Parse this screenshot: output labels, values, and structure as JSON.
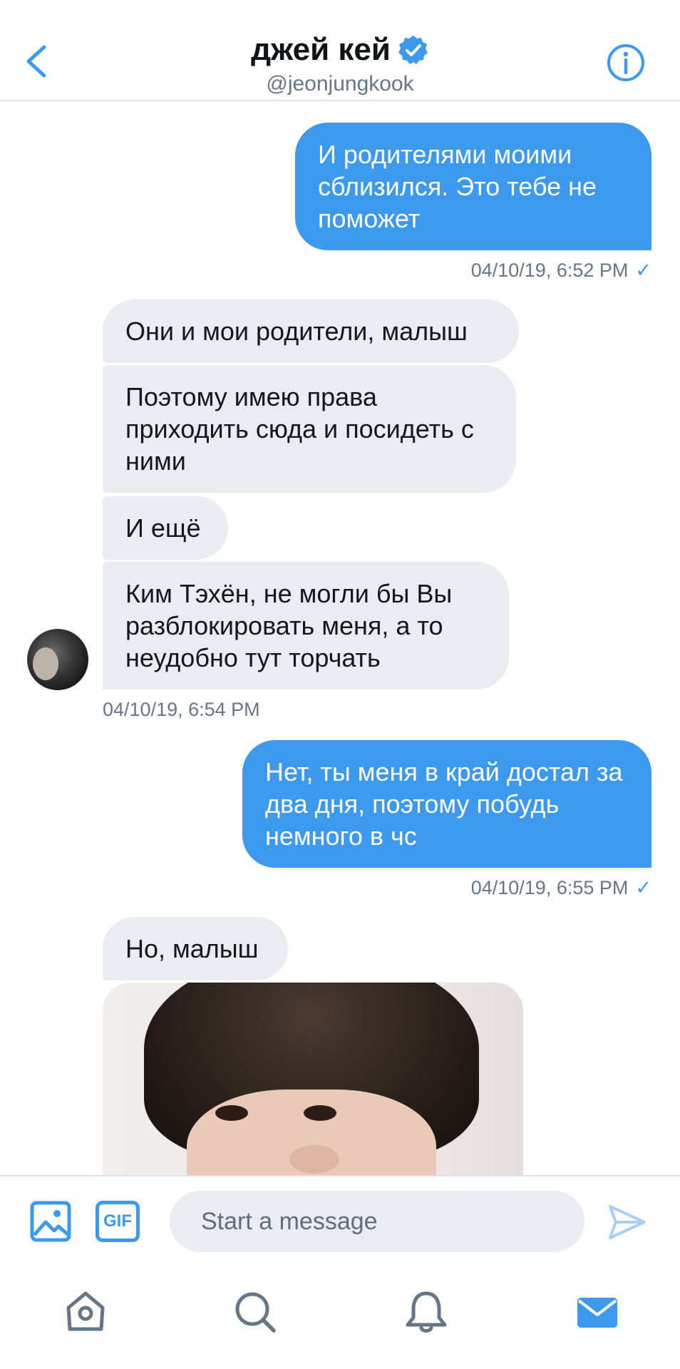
{
  "header": {
    "title": "джей кей",
    "handle": "@jeonjungkook",
    "verified": true
  },
  "messages": [
    {
      "direction": "out",
      "text": "И родителями моими сблизился. Это тебе не поможет"
    },
    {
      "direction": "out_ts",
      "text": "04/10/19, 6:52 PM"
    },
    {
      "direction": "in",
      "text": "Они и мои родители, малыш"
    },
    {
      "direction": "in",
      "text": "Поэтому имею права приходить сюда и посидеть с ними"
    },
    {
      "direction": "in",
      "text": "И ещё"
    },
    {
      "direction": "in",
      "text": "Ким Тэхён, не могли бы Вы разблокировать меня, а то неудобно тут торчать"
    },
    {
      "direction": "in_ts",
      "text": "04/10/19, 6:54 PM"
    },
    {
      "direction": "out",
      "text": "Нет, ты меня в край достал за два дня, поэтому побудь немного в чс"
    },
    {
      "direction": "out_ts",
      "text": "04/10/19, 6:55 PM"
    },
    {
      "direction": "in",
      "text": "Но, малыш"
    }
  ],
  "composer": {
    "gif_label": "GIF",
    "placeholder": "Start a message"
  },
  "tabs": [
    "home-icon",
    "search-icon",
    "notifications-icon",
    "messages-icon"
  ],
  "colors": {
    "accent": "#3d99ee",
    "incoming_bubble": "#e9ecf0",
    "muted_text": "#657786"
  }
}
